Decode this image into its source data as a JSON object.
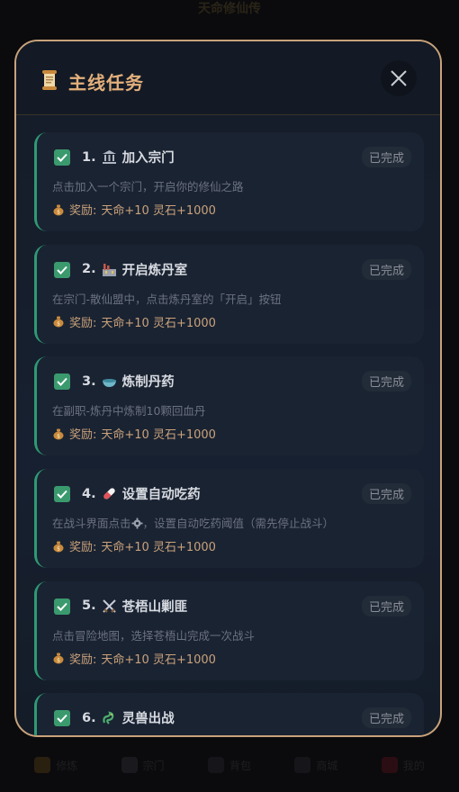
{
  "background": {
    "title": "天命修仙传",
    "nav": [
      "修炼",
      "宗门",
      "背包",
      "商城",
      "我的"
    ]
  },
  "modal": {
    "title": "主线任务",
    "close_icon": "close-icon",
    "title_icon": "scroll-icon"
  },
  "quests": [
    {
      "number": "1.",
      "icon": "temple-icon",
      "name": "加入宗门",
      "status": "已完成",
      "description": "点击加入一个宗门，开启你的修仙之路",
      "reward_label": "奖励:",
      "reward": "天命+10 灵石+1000"
    },
    {
      "number": "2.",
      "icon": "factory-icon",
      "name": "开启炼丹室",
      "status": "已完成",
      "description": "在宗门-散仙盟中，点击炼丹室的「开启」按钮",
      "reward_label": "奖励:",
      "reward": "天命+10 灵石+1000"
    },
    {
      "number": "3.",
      "icon": "bowl-icon",
      "name": "炼制丹药",
      "status": "已完成",
      "description": "在副职-炼丹中炼制10颗回血丹",
      "reward_label": "奖励:",
      "reward": "天命+10 灵石+1000"
    },
    {
      "number": "4.",
      "icon": "pill-icon",
      "name": "设置自动吃药",
      "status": "已完成",
      "description_a": "在战斗界面点击",
      "description_b": "，设置自动吃药阈值（需先停止战斗）",
      "reward_label": "奖励:",
      "reward": "天命+10 灵石+1000"
    },
    {
      "number": "5.",
      "icon": "crossed-swords-icon",
      "name": "苍梧山剿匪",
      "status": "已完成",
      "description": "点击冒险地图，选择苍梧山完成一次战斗",
      "reward_label": "奖励:",
      "reward": "天命+10 灵石+1000"
    },
    {
      "number": "6.",
      "icon": "dragon-icon",
      "name": "灵兽出战",
      "status": "已完成"
    }
  ],
  "colors": {
    "accent": "#e3b07c",
    "border": "#c9a27b",
    "check": "#3a9a6e",
    "card": "#1a2332"
  }
}
